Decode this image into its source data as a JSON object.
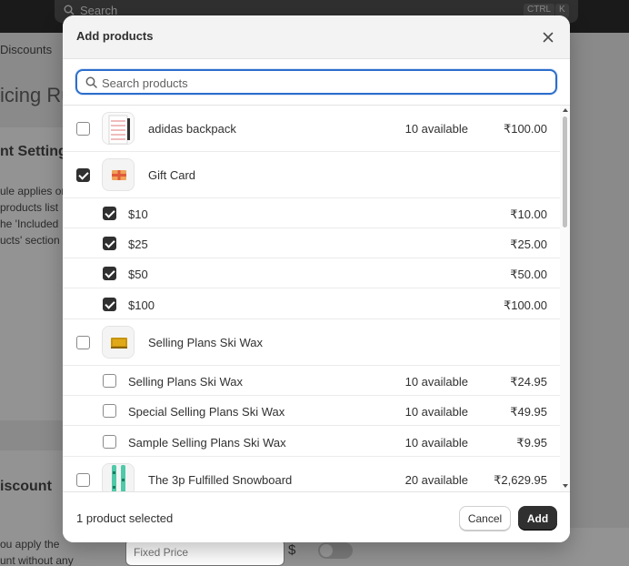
{
  "background": {
    "search_placeholder": "Search",
    "search_kbd_ctrl": "CTRL",
    "search_kbd_k": "K",
    "nav_discounts": "Discounts",
    "page_title_fragment": "icing Ru",
    "section_title_fragment": "nt Setting",
    "rule_text_lines": [
      "ule applies or",
      "products list",
      "he 'Included",
      "ucts' section"
    ],
    "section2_title_fragment": "iscount",
    "apply_text_lines": [
      "ou apply the",
      "unt without any"
    ],
    "fixed_price_placeholder": "Fixed Price",
    "currency_symbol": "$"
  },
  "modal": {
    "title": "Add products",
    "search": {
      "placeholder": "Search products",
      "value": ""
    },
    "products": [
      {
        "name": "adidas backpack",
        "checked": false,
        "available": "10 available",
        "price": "₹100.00",
        "thumb_icon": "backpack-image",
        "variants": []
      },
      {
        "name": "Gift Card",
        "checked": true,
        "available": "",
        "price": "",
        "thumb_icon": "gift-card-image",
        "variants": [
          {
            "name": "$10",
            "checked": true,
            "available": "",
            "price": "₹10.00"
          },
          {
            "name": "$25",
            "checked": true,
            "available": "",
            "price": "₹25.00"
          },
          {
            "name": "$50",
            "checked": true,
            "available": "",
            "price": "₹50.00"
          },
          {
            "name": "$100",
            "checked": true,
            "available": "",
            "price": "₹100.00"
          }
        ]
      },
      {
        "name": "Selling Plans Ski Wax",
        "checked": false,
        "available": "",
        "price": "",
        "thumb_icon": "ski-wax-image",
        "variants": [
          {
            "name": "Selling Plans Ski Wax",
            "checked": false,
            "available": "10 available",
            "price": "₹24.95"
          },
          {
            "name": "Special Selling Plans Ski Wax",
            "checked": false,
            "available": "10 available",
            "price": "₹49.95"
          },
          {
            "name": "Sample Selling Plans Ski Wax",
            "checked": false,
            "available": "10 available",
            "price": "₹9.95"
          }
        ]
      },
      {
        "name": "The 3p Fulfilled Snowboard",
        "checked": false,
        "available": "20 available",
        "price": "₹2,629.95",
        "thumb_icon": "snowboard-image",
        "variants": []
      }
    ],
    "footer": {
      "selected_text": "1 product selected",
      "cancel_label": "Cancel",
      "add_label": "Add"
    }
  },
  "colors": {
    "accent_focus": "#2c6ecb",
    "primary_button": "#303030",
    "overlay": "#6b6b6b"
  }
}
